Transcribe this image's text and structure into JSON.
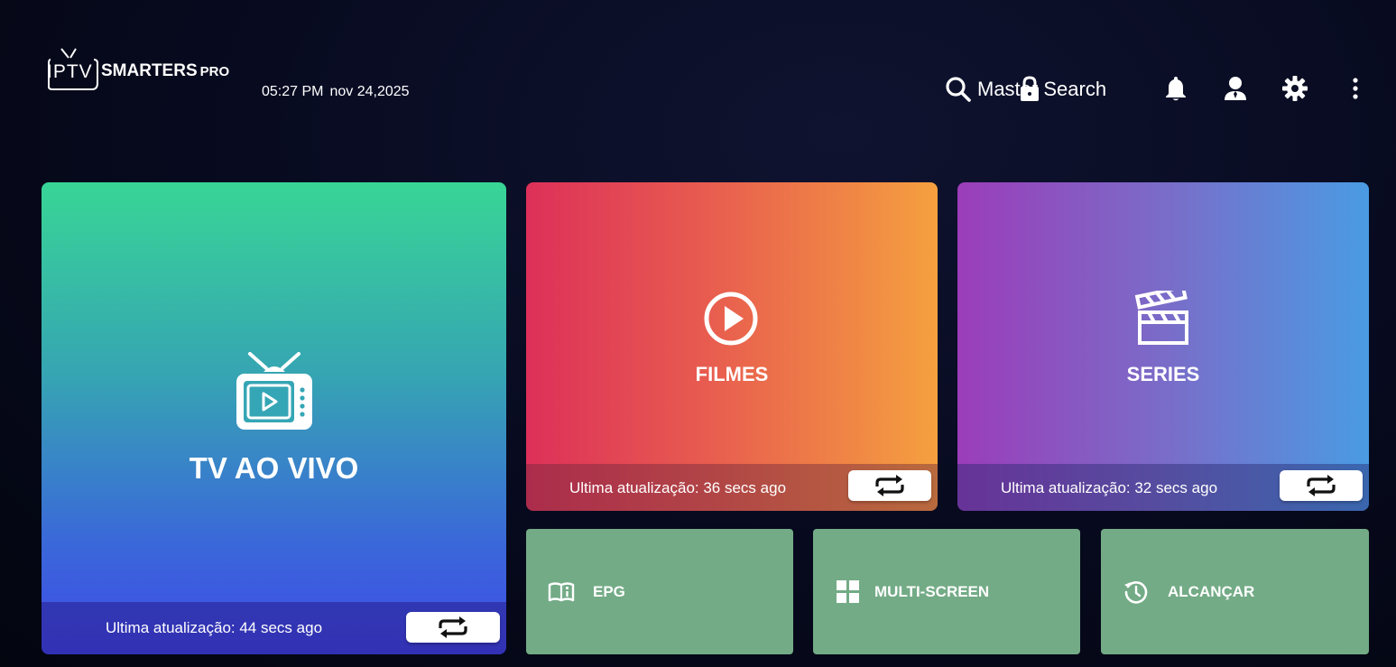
{
  "brand": {
    "logo_prefix": "IPTV",
    "logo_name": "SMARTERS",
    "logo_suffix": "PRO"
  },
  "header": {
    "time": "05:27 PM",
    "date": "nov 24,2025",
    "master_search_label": "Master Search",
    "icons": [
      "search-icon",
      "lock-icon",
      "bell-icon",
      "user-icon",
      "gear-icon",
      "more-vertical-icon"
    ]
  },
  "tiles": {
    "live": {
      "title": "TV AO VIVO",
      "last_update": "Ultima atualização: 44 secs ago",
      "icon": "tv-icon"
    },
    "movies": {
      "title": "FILMES",
      "last_update": "Ultima atualização: 36 secs ago",
      "icon": "play-circle-icon"
    },
    "series": {
      "title": "SERIES",
      "last_update": "Ultima atualização: 32 secs ago",
      "icon": "clapperboard-icon"
    }
  },
  "small_tiles": {
    "epg": {
      "label": "EPG",
      "icon": "book-info-icon"
    },
    "multi_screen": {
      "label": "MULTI-SCREEN",
      "icon": "grid-icon"
    },
    "catch_up": {
      "label": "ALCANÇAR",
      "icon": "history-icon"
    }
  },
  "colors": {
    "background": "#070a1e",
    "live_gradient": [
      "#38d596",
      "#3f4ae8"
    ],
    "movies_gradient": [
      "#dd3059",
      "#f5a03f"
    ],
    "series_gradient": [
      "#9b3db9",
      "#4a9be3"
    ],
    "small_tile": "#73ab86"
  }
}
